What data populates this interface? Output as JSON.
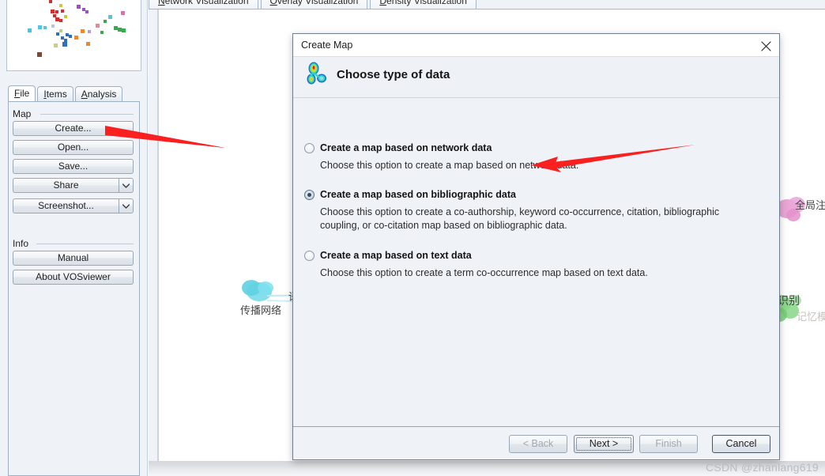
{
  "app": {
    "name": "VOSviewer"
  },
  "viz_tabs": [
    {
      "label": "Network Visualization",
      "mnemonic": "N",
      "active": true
    },
    {
      "label": "Overlay Visualization",
      "mnemonic": "O",
      "active": false
    },
    {
      "label": "Density Visualization",
      "mnemonic": "D",
      "active": false
    }
  ],
  "sidebar": {
    "tabs": [
      {
        "label": "File",
        "mnemonic": "F",
        "active": true
      },
      {
        "label": "Items",
        "mnemonic": "I",
        "active": false
      },
      {
        "label": "Analysis",
        "mnemonic": "A",
        "active": false
      }
    ],
    "groups": [
      {
        "label": "Map",
        "buttons": [
          {
            "label": "Create...",
            "type": "plain"
          },
          {
            "label": "Open...",
            "type": "plain"
          },
          {
            "label": "Save...",
            "type": "plain"
          },
          {
            "label": "Share",
            "type": "split",
            "arrow_icon": "chevron-down-icon"
          },
          {
            "label": "Screenshot...",
            "type": "split",
            "arrow_icon": "chevron-down-icon"
          }
        ]
      },
      {
        "label": "Info",
        "buttons": [
          {
            "label": "Manual",
            "type": "plain"
          },
          {
            "label": "About VOSviewer",
            "type": "plain"
          }
        ]
      }
    ]
  },
  "dialog": {
    "title": "Create Map",
    "close_icon": "close-icon",
    "header_icon": "vosviewer-density-icon",
    "header_title": "Choose type of data",
    "options": [
      {
        "label": "Create a map based on network data",
        "description": "Choose this option to create a map based on network data.",
        "selected": false
      },
      {
        "label": "Create a map based on bibliographic data",
        "description": "Choose this option to create a co-authorship, keyword co-occurrence, citation, bibliographic coupling, or co-citation map based on bibliographic data.",
        "selected": true
      },
      {
        "label": "Create a map based on text data",
        "description": "Choose this option to create a term co-occurrence map based on text data.",
        "selected": false
      }
    ],
    "buttons": [
      {
        "label": "< Back",
        "state": "disabled"
      },
      {
        "label": "Next >",
        "state": "focused"
      },
      {
        "label": "Finish",
        "state": "disabled"
      },
      {
        "label": "Cancel",
        "state": "default"
      }
    ]
  },
  "canvas": {
    "node_labels": [
      {
        "text": "传播网络",
        "color": "#4a4a4a"
      },
      {
        "text": "语",
        "color": "#4a4a4a"
      },
      {
        "text": "全局注意力机",
        "color": "#4a4a4a"
      },
      {
        "text": "识别",
        "color": "#3b3b3b"
      },
      {
        "text": "记忆模型",
        "color": "#c9c2bd"
      }
    ]
  },
  "annotations": {
    "arrows": [
      {
        "name": "arrow-to-create-button",
        "color": "#fb2020"
      },
      {
        "name": "arrow-to-bibliographic-option",
        "color": "#fb2020"
      }
    ]
  },
  "watermark": {
    "text": "CSDN @zhanlang619"
  },
  "colors": {
    "panel_bg": "#eff3f8",
    "dialog_bg": "#eff3f8",
    "accent_red": "#fb2020",
    "border": "#9aa7b5"
  }
}
